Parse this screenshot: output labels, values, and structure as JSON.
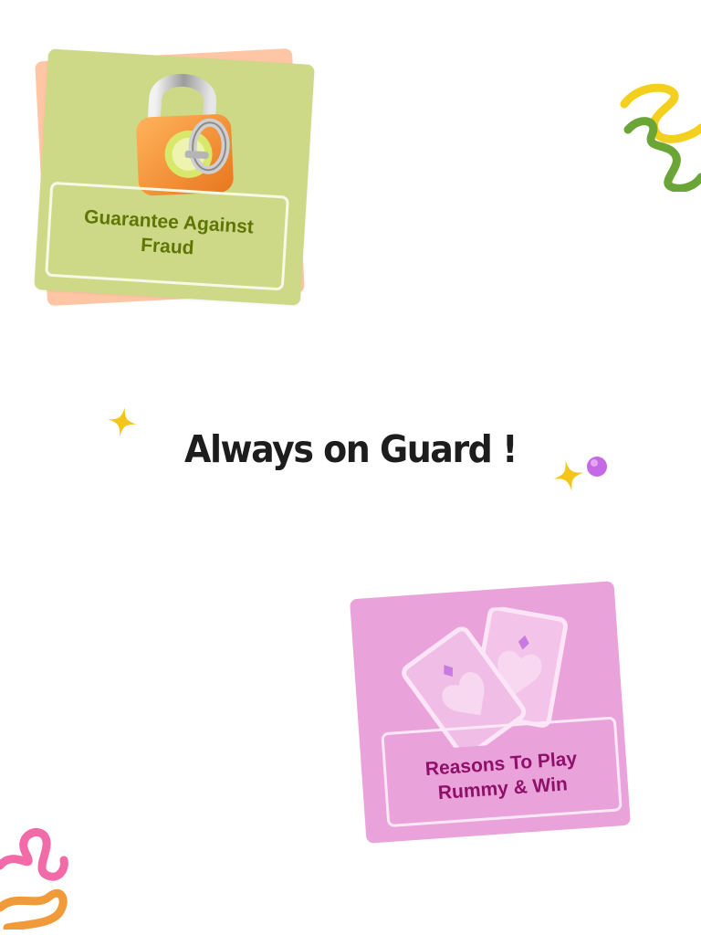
{
  "headline": "Always on Guard !",
  "cards": [
    {
      "label_line1": "Guarantee Against",
      "label_line2": "Fraud",
      "icon": "padlock-key-icon"
    },
    {
      "label_line1": "Reasons To Play",
      "label_line2": "Rummy & Win",
      "icon": "playing-cards-heart-icon"
    }
  ],
  "colors": {
    "card_green": "#cdd986",
    "card_peach": "#ffc6a5",
    "card_pink": "#e9a2da",
    "text_green": "#5f7607",
    "text_pink": "#8e1069",
    "headline": "#1d1d1d"
  }
}
